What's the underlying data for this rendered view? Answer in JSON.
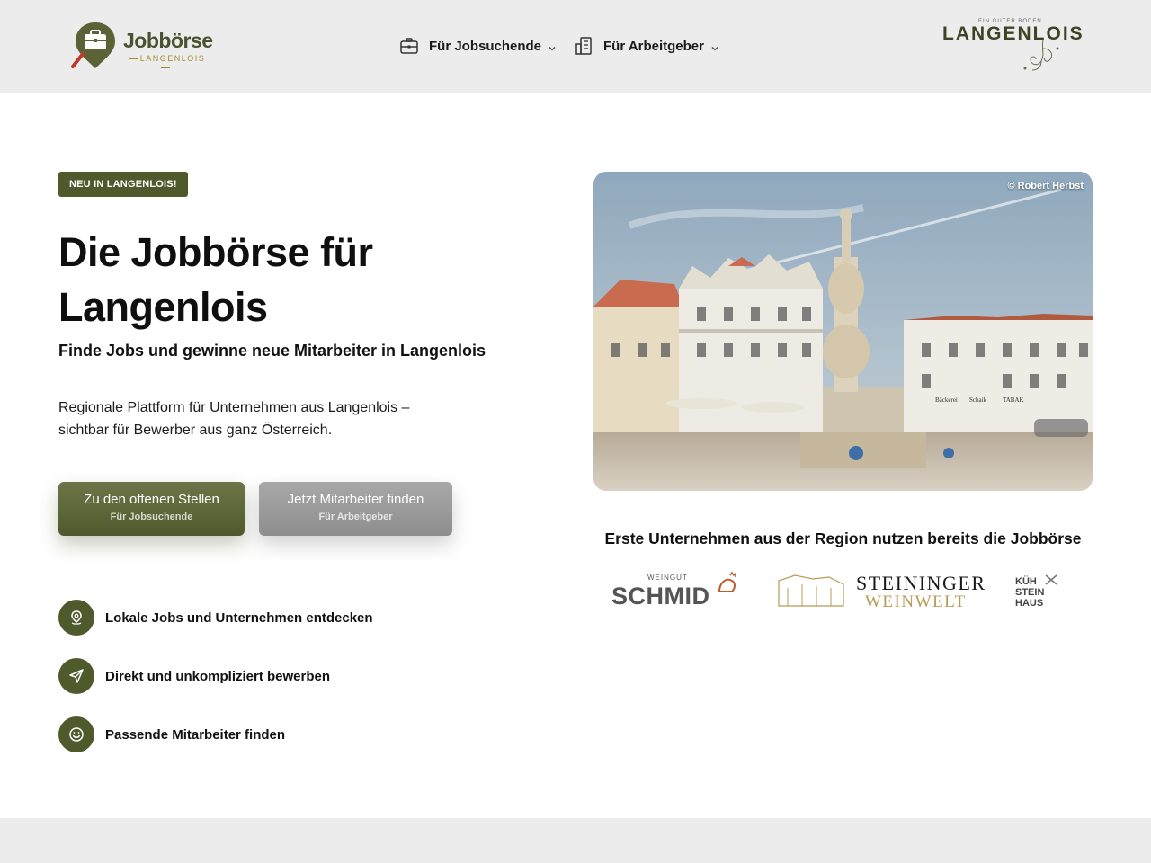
{
  "header": {
    "logo": {
      "title": "Jobbörse",
      "subtitle": "LANGENLOIS"
    },
    "nav": [
      {
        "label": "Für Jobsuchende",
        "icon": "briefcase-icon"
      },
      {
        "label": "Für Arbeitgeber",
        "icon": "building-icon"
      }
    ],
    "brand": {
      "tagline": "EIN GUTER BODEN",
      "name": "LANGENLOIS"
    }
  },
  "hero": {
    "badge": "NEU IN LANGENLOIS!",
    "title": "Die Jobbörse für Langenlois",
    "subtitle": "Finde Jobs und gewinne neue Mitarbeiter in Langenlois",
    "description": "Regionale Plattform für Unternehmen aus Langenlois – sichtbar für Bewerber aus ganz Österreich.",
    "primary_button": {
      "label": "Zu den offenen Stellen",
      "sublabel": "Für Jobsuchende"
    },
    "secondary_button": {
      "label": "Jetzt Mitarbeiter finden",
      "sublabel": "Für Arbeitgeber"
    },
    "features": [
      {
        "text": "Lokale Jobs und Unternehmen entdecken",
        "icon": "location-pin-icon"
      },
      {
        "text": "Direkt und unkompliziert bewerben",
        "icon": "paper-plane-icon"
      },
      {
        "text": "Passende Mitarbeiter finden",
        "icon": "smiley-icon"
      }
    ]
  },
  "photo": {
    "credit": "© Robert Herbst",
    "signs": [
      "Bäckerei",
      "Schaik",
      "TABAK"
    ]
  },
  "partners": {
    "title": "Erste Unternehmen aus der Region nutzen bereits die Jobbörse",
    "logos": [
      {
        "top": "WEINGUT",
        "name": "SCHMID"
      },
      {
        "name": "STEININGER",
        "sub": "WEINWELT"
      },
      {
        "lines": [
          "KÜH",
          "STEIN",
          "HAUS"
        ]
      }
    ]
  },
  "colors": {
    "accent": "#4f5a2c",
    "header_bg": "#ececec",
    "secondary_button": "#999999",
    "gold": "#b89a55"
  }
}
